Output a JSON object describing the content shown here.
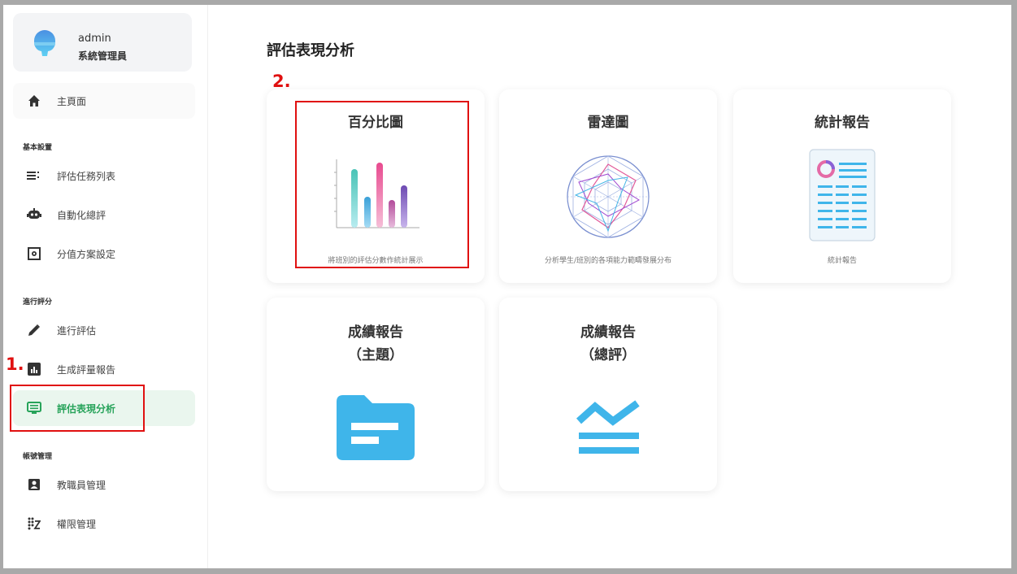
{
  "user": {
    "name": "admin",
    "role": "系統管理員"
  },
  "sidebar": {
    "home": {
      "label": "主頁面",
      "icon": "home-icon"
    },
    "sections": [
      {
        "title": "基本設置",
        "items": [
          {
            "label": "評估任務列表",
            "icon": "list-icon"
          },
          {
            "label": "自動化總評",
            "icon": "robot-icon"
          },
          {
            "label": "分值方案設定",
            "icon": "settings-box-icon"
          }
        ]
      },
      {
        "title": "進行評分",
        "items": [
          {
            "label": "進行評估",
            "icon": "pencil-icon"
          },
          {
            "label": "生成評量報告",
            "icon": "bar-chart-icon"
          },
          {
            "label": "評估表現分析",
            "icon": "monitor-list-icon",
            "active": true
          }
        ]
      },
      {
        "title": "帳號管理",
        "items": [
          {
            "label": "教職員管理",
            "icon": "id-badge-icon"
          },
          {
            "label": "權限管理",
            "icon": "permission-icon"
          }
        ]
      }
    ]
  },
  "main": {
    "title": "評估表現分析",
    "cards": [
      {
        "title": "百分比圖",
        "desc": "將班別的評估分數作統計展示",
        "icon": "bar-chart-art"
      },
      {
        "title": "雷達圖",
        "desc": "分析學生/班別的各項能力範疇發展分布",
        "icon": "radar-chart-art"
      },
      {
        "title": "統計報告",
        "desc": "統計報告",
        "icon": "report-document-art"
      },
      {
        "title_line1": "成績報告",
        "title_line2": "（主題）",
        "icon": "folder-icon"
      },
      {
        "title_line1": "成績報告",
        "title_line2": "（總評）",
        "icon": "trend-lines-icon"
      }
    ]
  },
  "annotations": {
    "step1": "1.",
    "step2": "2.",
    "color": "#e01010"
  },
  "colors": {
    "accent": "#27a35a",
    "active_bg": "#eaf6ee",
    "icon_blue": "#3fb5ea"
  }
}
